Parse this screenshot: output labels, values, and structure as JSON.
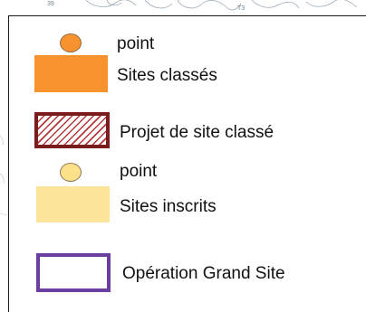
{
  "map_fragment": {
    "label_left": "39",
    "label_right": "T3"
  },
  "legend": {
    "colors": {
      "classe": "#f7922f",
      "projet_border": "#7a1d1f",
      "projet_hatch": "#b23a3a",
      "inscrit_point": "#fde08a",
      "inscrit_area": "#fde49b",
      "ogs_border": "#6b3fa0"
    },
    "items": [
      {
        "id": "classe-point",
        "label": "point",
        "icon": "orange-circle-icon"
      },
      {
        "id": "classe-area",
        "label": "Sites classés",
        "icon": "orange-rectangle-icon"
      },
      {
        "id": "projet",
        "label": "Projet de site classé",
        "icon": "hatched-rectangle-icon"
      },
      {
        "id": "inscrit-point",
        "label": "point",
        "icon": "yellow-circle-icon"
      },
      {
        "id": "inscrit-area",
        "label": "Sites inscrits",
        "icon": "yellow-rectangle-icon"
      },
      {
        "id": "ogs",
        "label": "Opération Grand Site",
        "icon": "purple-outline-rectangle-icon"
      }
    ]
  }
}
